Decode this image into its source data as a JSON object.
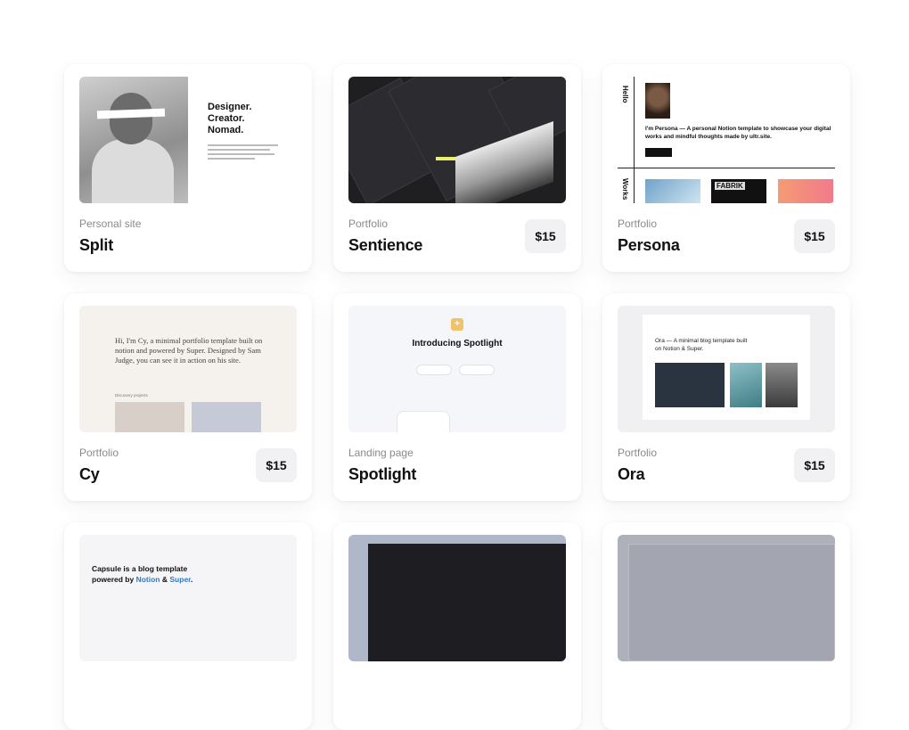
{
  "cards": [
    {
      "category": "Personal site",
      "title": "Split",
      "price": ""
    },
    {
      "category": "Portfolio",
      "title": "Sentience",
      "price": "$15"
    },
    {
      "category": "Portfolio",
      "title": "Persona",
      "price": "$15"
    },
    {
      "category": "Portfolio",
      "title": "Cy",
      "price": "$15"
    },
    {
      "category": "Landing page",
      "title": "Spotlight",
      "price": ""
    },
    {
      "category": "Portfolio",
      "title": "Ora",
      "price": "$15"
    }
  ],
  "thumbs": {
    "split": {
      "hero": "Designer.\nCreator.\nNomad."
    },
    "persona": {
      "hello": "Hello",
      "works": "Works",
      "blurb": "I'm Persona — A personal Notion template to showcase your digital works and mindful thoughts made by ultr.site.",
      "tag": "FABRIK"
    },
    "cy": {
      "text": "Hi, I'm Cy, a minimal portfolio template built on notion and powered by Super. Designed by Sam Judge, you can see it in action on his site.",
      "label": "Discovery projects"
    },
    "spotlight": {
      "heading": "Introducing Spotlight"
    },
    "ora": {
      "heading": "Ora — A minimal blog template built on Notion & Super."
    },
    "capsule": {
      "line1": "Capsule is a blog template",
      "line2_prefix": "powered by ",
      "notion": "Notion",
      "amp": " & ",
      "super": "Super",
      "period": "."
    }
  }
}
